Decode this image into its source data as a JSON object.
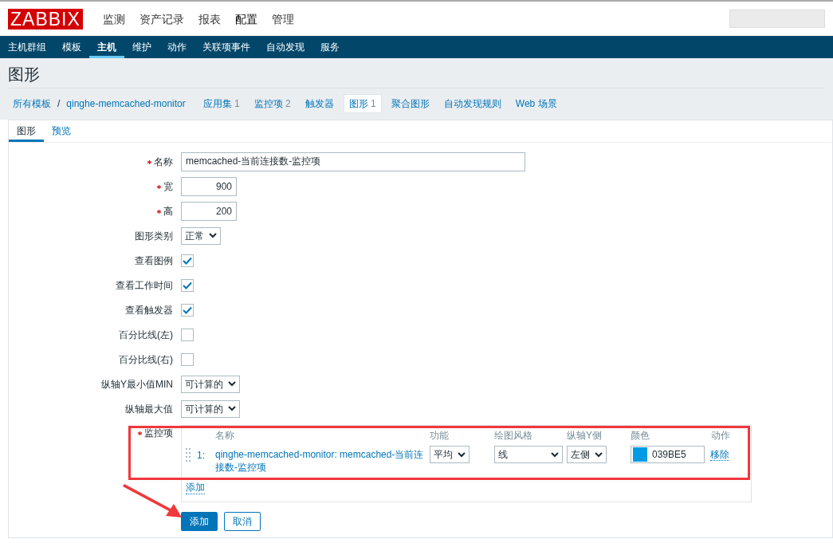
{
  "header": {
    "logo": "ZABBIX",
    "menu": [
      {
        "label": "监测",
        "selected": false
      },
      {
        "label": "资产记录",
        "selected": false
      },
      {
        "label": "报表",
        "selected": false
      },
      {
        "label": "配置",
        "selected": true
      },
      {
        "label": "管理",
        "selected": false
      }
    ]
  },
  "subnav": [
    {
      "label": "主机群组",
      "selected": false
    },
    {
      "label": "模板",
      "selected": false
    },
    {
      "label": "主机",
      "selected": true
    },
    {
      "label": "维护",
      "selected": false
    },
    {
      "label": "动作",
      "selected": false
    },
    {
      "label": "关联项事件",
      "selected": false
    },
    {
      "label": "自动发现",
      "selected": false
    },
    {
      "label": "服务",
      "selected": false
    }
  ],
  "page_title": "图形",
  "breadcrumb": {
    "root": "所有模板",
    "separator": "/",
    "host": "qinghe-memcached-monitor",
    "tabs": [
      {
        "label": "应用集",
        "count": "1",
        "selected": false
      },
      {
        "label": "监控项",
        "count": "2",
        "selected": false
      },
      {
        "label": "触发器",
        "selected": false
      },
      {
        "label": "图形",
        "count": "1",
        "selected": true
      },
      {
        "label": "聚合图形",
        "selected": false
      },
      {
        "label": "自动发现规则",
        "selected": false
      },
      {
        "label": "Web 场景",
        "selected": false
      }
    ]
  },
  "form_tabs": [
    {
      "label": "图形",
      "selected": true
    },
    {
      "label": "预览",
      "selected": false
    }
  ],
  "fields": [
    {
      "kind": "text",
      "label": "名称",
      "required": true,
      "value": "memcached-当前连接数-监控项"
    },
    {
      "kind": "number",
      "label": "宽",
      "required": true,
      "value": "900"
    },
    {
      "kind": "number",
      "label": "高",
      "required": true,
      "value": "200"
    },
    {
      "kind": "select",
      "label": "图形类别",
      "required": false,
      "value": "正常"
    },
    {
      "kind": "checkbox",
      "label": "查看图例",
      "required": false,
      "checked": true
    },
    {
      "kind": "checkbox",
      "label": "查看工作时间",
      "required": false,
      "checked": true
    },
    {
      "kind": "checkbox",
      "label": "查看触发器",
      "required": false,
      "checked": true
    },
    {
      "kind": "checkbox",
      "label": "百分比线(左)",
      "required": false,
      "checked": false
    },
    {
      "kind": "checkbox",
      "label": "百分比线(右)",
      "required": false,
      "checked": false
    },
    {
      "kind": "select",
      "label": "纵轴Y最小值MIN",
      "required": false,
      "value": "可计算的"
    },
    {
      "kind": "select",
      "label": "纵轴最大值",
      "required": false,
      "value": "可计算的"
    }
  ],
  "items": {
    "label": "监控项",
    "required": true,
    "columns": [
      "名称",
      "功能",
      "绘图风格",
      "纵轴Y侧",
      "颜色",
      "动作"
    ],
    "rows": [
      {
        "index": "1:",
        "name": "qinghe-memcached-monitor: memcached-当前连接数-监控项",
        "function": "平均",
        "draw_style": "线",
        "y_axis": "左侧",
        "color": "#039be5",
        "color_code": "039BE5",
        "action": "移除"
      }
    ],
    "add_link": "添加"
  },
  "buttons": [
    {
      "label": "添加",
      "primary": true
    },
    {
      "label": "取消",
      "primary": false
    }
  ]
}
